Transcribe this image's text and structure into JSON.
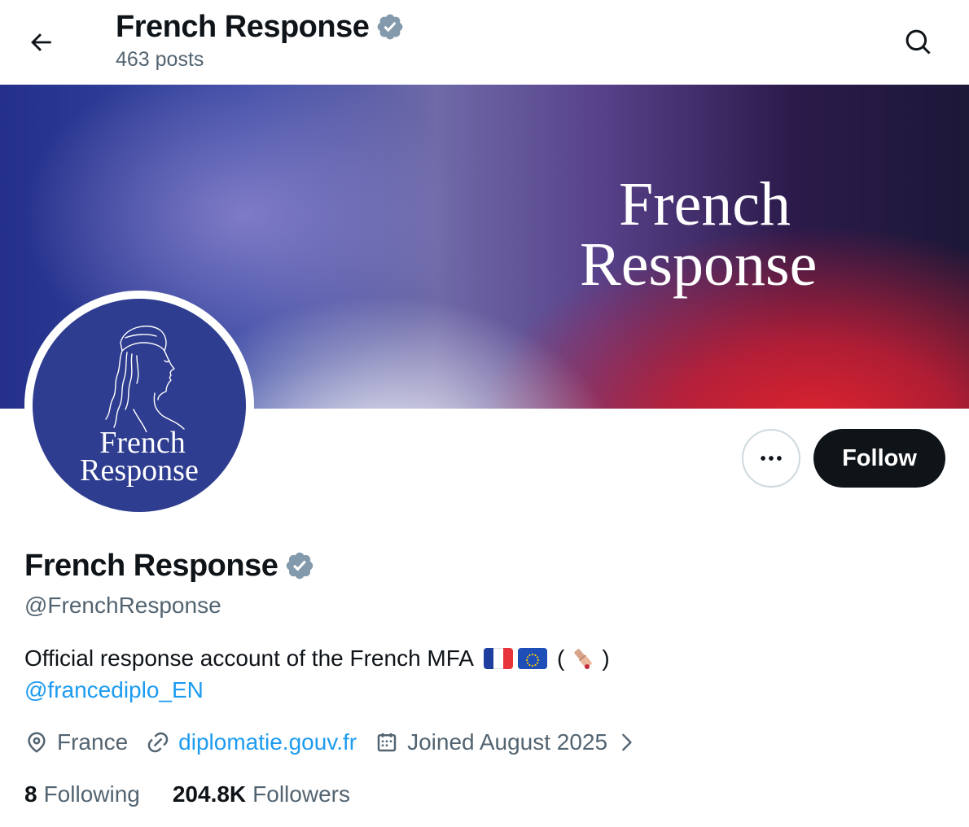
{
  "header": {
    "name": "French Response",
    "posts": "463 posts"
  },
  "banner": {
    "line1": "French",
    "line2": "Response"
  },
  "avatar": {
    "line1": "French",
    "line2": "Response"
  },
  "actions": {
    "follow_label": "Follow"
  },
  "profile": {
    "name": "French Response",
    "handle": "@FrenchResponse",
    "bio_text": "Official response account of the French MFA",
    "bio_paren_open": "(",
    "bio_paren_close": ")",
    "bio_mention": "@francediplo_EN",
    "location": "France",
    "website": "diplomatie.gouv.fr",
    "joined": "Joined August 2025"
  },
  "stats": {
    "following_count": "8",
    "following_label": "Following",
    "followers_count": "204.8K",
    "followers_label": "Followers"
  },
  "colors": {
    "accent": "#1d9bf0",
    "verified": "#829aab",
    "text_primary": "#0f1419",
    "text_secondary": "#536471",
    "avatar_bg": "#2e3d8f"
  },
  "icons": [
    "back-arrow-icon",
    "search-icon",
    "verified-badge-icon",
    "more-icon",
    "location-icon",
    "link-icon",
    "calendar-icon",
    "chevron-right-icon"
  ]
}
